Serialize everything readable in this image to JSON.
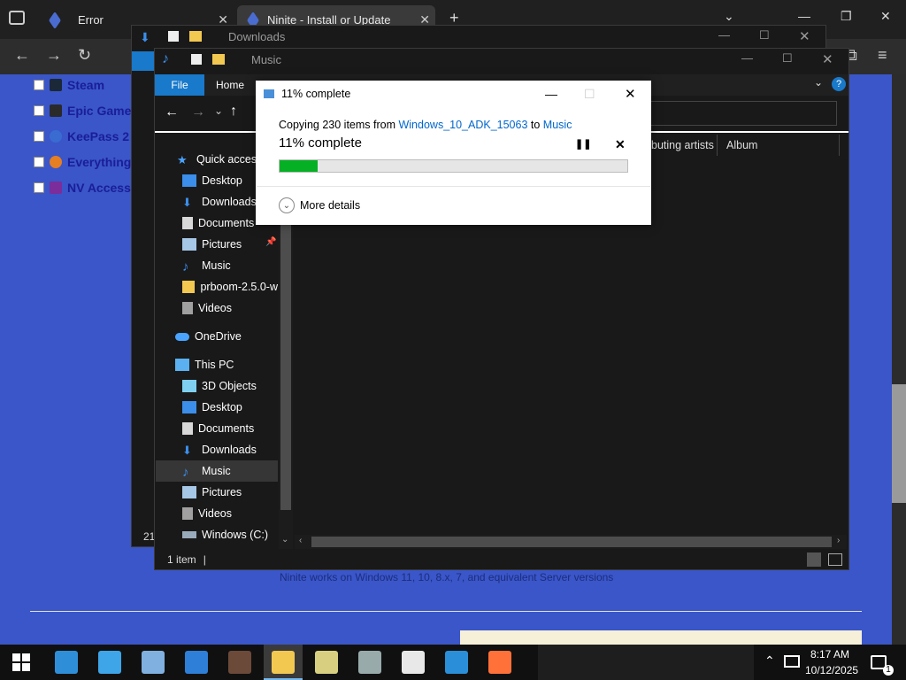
{
  "browser": {
    "tabs": [
      {
        "title": "Error"
      },
      {
        "title": "Ninite - Install or Update Multi"
      }
    ],
    "new_tab": "+"
  },
  "webpage": {
    "apps": [
      {
        "label": "Steam",
        "icon": "steam-icon",
        "color": "#1b2838"
      },
      {
        "label": "Epic Games",
        "icon": "epic-games-icon",
        "color": "#2a2a2a"
      },
      {
        "label": "KeePass 2",
        "icon": "keepass-icon",
        "color": "#3a6bd1"
      },
      {
        "label": "Everything",
        "icon": "everything-icon",
        "color": "#e67e22"
      },
      {
        "label": "NV Access",
        "icon": "nvaccess-icon",
        "color": "#7b2d9b"
      }
    ],
    "footer_note": "Ninite works on Windows 11, 10, 8.x, 7, and equivalent Server versions"
  },
  "explorer_back": {
    "title": "Downloads",
    "left_cut_text": "21"
  },
  "explorer": {
    "title": "Music",
    "tabs": {
      "file": "File",
      "home": "Home"
    },
    "columns": [
      "buting artists",
      "Album"
    ],
    "nav": [
      {
        "label": "Quick access",
        "icon": "star-icon",
        "color": "#4aa3ff"
      },
      {
        "label": "Desktop",
        "icon": "desktop-icon",
        "color": "#3b8eea"
      },
      {
        "label": "Downloads",
        "icon": "download-icon",
        "color": "#3b8eea"
      },
      {
        "label": "Documents",
        "icon": "document-icon",
        "color": "#d8d8d8"
      },
      {
        "label": "Pictures",
        "icon": "pictures-icon",
        "color": "#a7c7e7"
      },
      {
        "label": "Music",
        "icon": "music-icon",
        "color": "#3b8eea"
      },
      {
        "label": "prboom-2.5.0-w",
        "icon": "folder-icon",
        "color": "#f3c851"
      },
      {
        "label": "Videos",
        "icon": "videos-icon",
        "color": "#a0a0a0"
      },
      {
        "label": "OneDrive",
        "icon": "onedrive-icon",
        "color": "#4aa3ff"
      },
      {
        "label": "This PC",
        "icon": "pc-icon",
        "color": "#5ab0f0"
      },
      {
        "label": "3D Objects",
        "icon": "cube-icon",
        "color": "#7fd0f0"
      },
      {
        "label": "Desktop",
        "icon": "desktop-icon",
        "color": "#3b8eea"
      },
      {
        "label": "Documents",
        "icon": "document-icon",
        "color": "#d8d8d8"
      },
      {
        "label": "Downloads",
        "icon": "download-icon",
        "color": "#3b8eea"
      },
      {
        "label": "Music",
        "icon": "music-icon",
        "color": "#3b8eea"
      },
      {
        "label": "Pictures",
        "icon": "pictures-icon",
        "color": "#a7c7e7"
      },
      {
        "label": "Videos",
        "icon": "videos-icon",
        "color": "#a0a0a0"
      },
      {
        "label": "Windows (C:)",
        "icon": "drive-icon",
        "color": "#9ab"
      }
    ],
    "selected_nav": "Music",
    "status": "1 item"
  },
  "copy_dialog": {
    "title": "11% complete",
    "message_prefix": "Copying 230 items from ",
    "source": "Windows_10_ADK_15063",
    "message_mid": " to ",
    "destination": "Music",
    "percent_text": "11% complete",
    "progress": 0.11,
    "more_details": "More details",
    "accent": "#06b025"
  },
  "taskbar": {
    "time": "8:17 AM",
    "date": "10/12/2025",
    "pinned": [
      {
        "name": "search-app-icon",
        "color": "#2e8fd8"
      },
      {
        "name": "monitor-app-icon",
        "color": "#3da5e8"
      },
      {
        "name": "notes-app-icon",
        "color": "#7fb0e0"
      },
      {
        "name": "drop-app-icon",
        "color": "#2e7fd8"
      },
      {
        "name": "profile-app-icon",
        "color": "#6b4a3a"
      },
      {
        "name": "file-explorer-icon",
        "color": "#f3c851"
      },
      {
        "name": "xd-app-icon",
        "color": "#d8d080"
      },
      {
        "name": "installer-app-icon",
        "color": "#9aa"
      },
      {
        "name": "7zip-icon",
        "color": "#e8e8e8"
      },
      {
        "name": "globe-app-icon",
        "color": "#2a8fd8"
      },
      {
        "name": "firefox-icon",
        "color": "#ff7139"
      }
    ],
    "notification_count": "1"
  }
}
